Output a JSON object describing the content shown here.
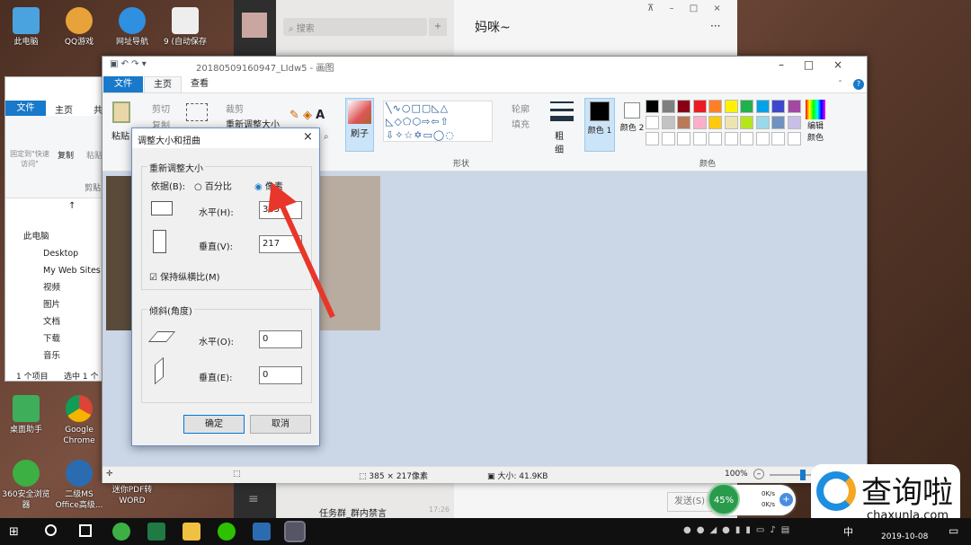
{
  "desktop": {
    "icons": [
      "此电脑",
      "QQ游戏",
      "网址导航",
      "9 (自动保存",
      "桌面助手",
      "Google Chrome",
      "360安全浏览器",
      "二级MS Office高级...",
      "迷你PDF转WORD"
    ]
  },
  "wechat": {
    "search_placeholder": "搜索",
    "add": "+",
    "chat_title": "妈咪~",
    "more": "···",
    "window_controls": [
      "⊼",
      "–",
      "□",
      "×"
    ],
    "list_items": [
      {
        "name": "任务群_群内禁言",
        "time": "17:26"
      }
    ],
    "send": "发送(S)"
  },
  "explorer": {
    "tabs": [
      "文件",
      "主页",
      "共"
    ],
    "ribbon": [
      "固定到\"快速访问\"",
      "复制",
      "粘贴",
      "剪贴"
    ],
    "tree": [
      "此电脑",
      "Desktop",
      "My Web Sites",
      "视频",
      "图片",
      "文档",
      "下载",
      "音乐"
    ],
    "status": [
      "1 个项目",
      "选中 1 个"
    ]
  },
  "paint": {
    "title": "20180509160947_LIdw5 - 画图",
    "tabs": [
      "文件",
      "主页",
      "查看"
    ],
    "clipboard": {
      "paste": "粘贴",
      "cut": "剪切",
      "copy": "复制"
    },
    "image": {
      "crop": "裁剪",
      "resize": "重新调整大小"
    },
    "brush": "刷子",
    "shapes_label": "形状",
    "outline": "轮廓",
    "fill": "填充",
    "size": "粗细",
    "color1": "颜色 1",
    "color2": "颜色 2",
    "edit_colors": "编辑颜色",
    "colors_label": "颜色",
    "palette": [
      "#000000",
      "#7f7f7f",
      "#880015",
      "#ed1c24",
      "#ff7f27",
      "#fff200",
      "#22b14c",
      "#00a2e8",
      "#3f48cc",
      "#a349a4",
      "#ffffff",
      "#c3c3c3",
      "#b97a57",
      "#ffaec9",
      "#ffc90e",
      "#efe4b0",
      "#b5e61d",
      "#99d9ea",
      "#7092be",
      "#c8bfe7"
    ],
    "status": {
      "dimensions": "385 × 217像素",
      "size": "大小: 41.9KB",
      "zoom": "100%"
    }
  },
  "dialog": {
    "title": "调整大小和扭曲",
    "resize_group": "重新调整大小",
    "by_label": "依据(B):",
    "percent": "百分比",
    "pixels": "像素",
    "horizontal": "水平(H):",
    "vertical": "垂直(V):",
    "h_value": "385",
    "v_value": "217",
    "keep_ratio": "保持纵横比(M)",
    "skew_group": "倾斜(角度)",
    "skew_h": "水平(O):",
    "skew_v": "垂直(E):",
    "skew_h_value": "0",
    "skew_v_value": "0",
    "ok": "确定",
    "cancel": "取消"
  },
  "netspeed": {
    "percent": "45%",
    "up": "0K/s",
    "down": "0K/s"
  },
  "taskbar": {
    "date": "2019-10-08",
    "ime": "中"
  },
  "watermark": {
    "text": "查询啦",
    "url": "chaxunla.com"
  }
}
